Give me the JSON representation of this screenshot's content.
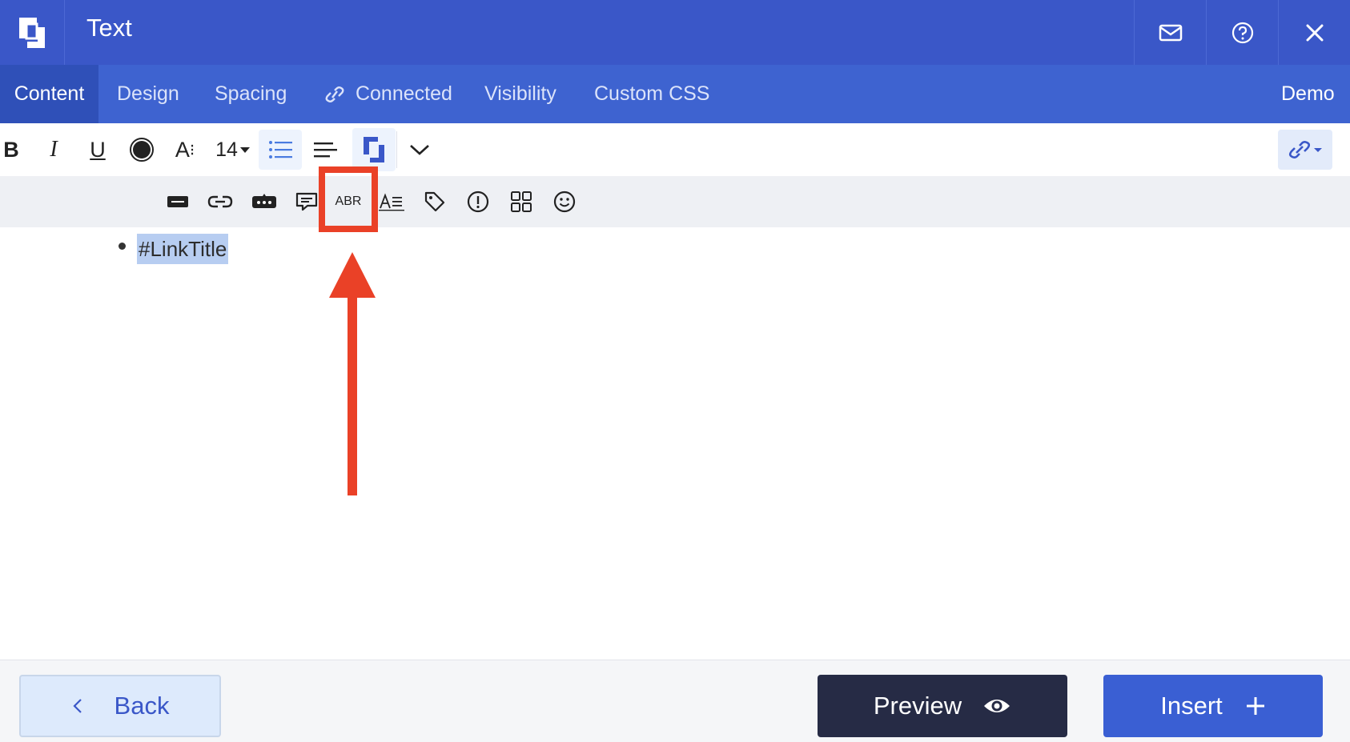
{
  "window": {
    "title": "Text"
  },
  "tabs": [
    {
      "label": "Content",
      "active": true
    },
    {
      "label": "Design"
    },
    {
      "label": "Spacing"
    },
    {
      "label": "Connected",
      "icon": "link-icon"
    },
    {
      "label": "Visibility"
    },
    {
      "label": "Custom CSS"
    }
  ],
  "demo_label": "Demo",
  "toolbar": {
    "bold": "B",
    "italic": "I",
    "underline": "U",
    "font_size_prefix": "A",
    "font_size_value": "14",
    "abbr_label": "ABR"
  },
  "editor": {
    "list_items": [
      "#LinkTitle"
    ]
  },
  "footer": {
    "back_label": "Back",
    "preview_label": "Preview",
    "insert_label": "Insert"
  },
  "colors": {
    "header": "#3a57c8",
    "tab_bar": "#3e63d0",
    "annotation": "#ea4127",
    "preview_button": "#262b45",
    "insert_button": "#3a5fd3"
  }
}
